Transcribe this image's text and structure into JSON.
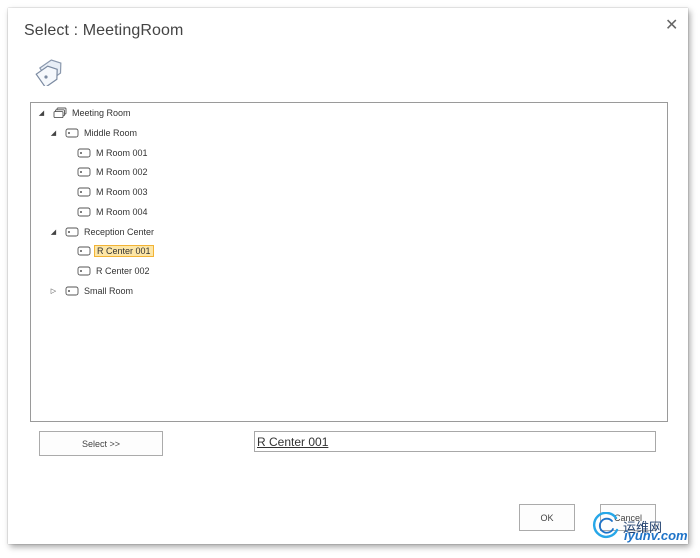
{
  "dialog": {
    "title": "Select : MeetingRoom",
    "close_label": "✕"
  },
  "tree": {
    "nodes": [
      {
        "label": "Meeting Room",
        "toggle": "◢",
        "icon": "meeting-room-group-icon"
      },
      {
        "label": "Middle Room",
        "toggle": "◢",
        "icon": "room-tag-icon"
      },
      {
        "label": "M Room 001",
        "toggle": "",
        "icon": "room-tag-icon"
      },
      {
        "label": "M Room 002",
        "toggle": "",
        "icon": "room-tag-icon"
      },
      {
        "label": "M Room 003",
        "toggle": "",
        "icon": "room-tag-icon"
      },
      {
        "label": "M Room 004",
        "toggle": "",
        "icon": "room-tag-icon"
      },
      {
        "label": "Reception Center",
        "toggle": "◢",
        "icon": "room-tag-icon"
      },
      {
        "label": "R Center 001",
        "toggle": "",
        "icon": "room-tag-icon",
        "selected": true
      },
      {
        "label": "R Center 002",
        "toggle": "",
        "icon": "room-tag-icon"
      },
      {
        "label": "Small Room",
        "toggle": "▷",
        "icon": "room-tag-icon"
      }
    ]
  },
  "selection": {
    "button_label": "Select >>",
    "value": "R Center 001"
  },
  "footer": {
    "ok_label": "OK",
    "cancel_label": "Cancel"
  },
  "watermark": {
    "text": "运维网",
    "sub": "iyunv.com"
  },
  "colors": {
    "selected_fill": "#fde6a6",
    "selected_border": "#f2b335",
    "tree_border": "#9a9a9a"
  }
}
